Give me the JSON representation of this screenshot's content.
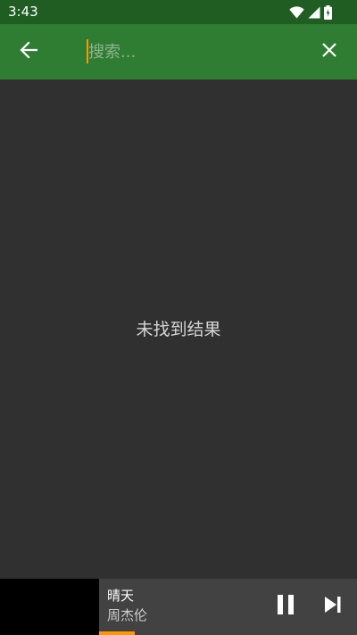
{
  "status_bar": {
    "time": "3:43",
    "icons": [
      "wifi-icon",
      "cellular-signal-icon",
      "battery-charging-icon"
    ]
  },
  "toolbar": {
    "back_icon": "arrow-left-icon",
    "search": {
      "placeholder": "搜索...",
      "value": ""
    },
    "clear_icon": "close-icon"
  },
  "results": {
    "empty_message": "未找到结果"
  },
  "player": {
    "title": "晴天",
    "artist": "周杰伦",
    "progress": 0.14,
    "pause_icon": "pause-icon",
    "next_icon": "skip-next-icon"
  },
  "colors": {
    "status_bar": "#1f5d23",
    "toolbar": "#2e7d32",
    "background": "#303030",
    "player_bar": "#424242",
    "accent": "#ff9800"
  }
}
